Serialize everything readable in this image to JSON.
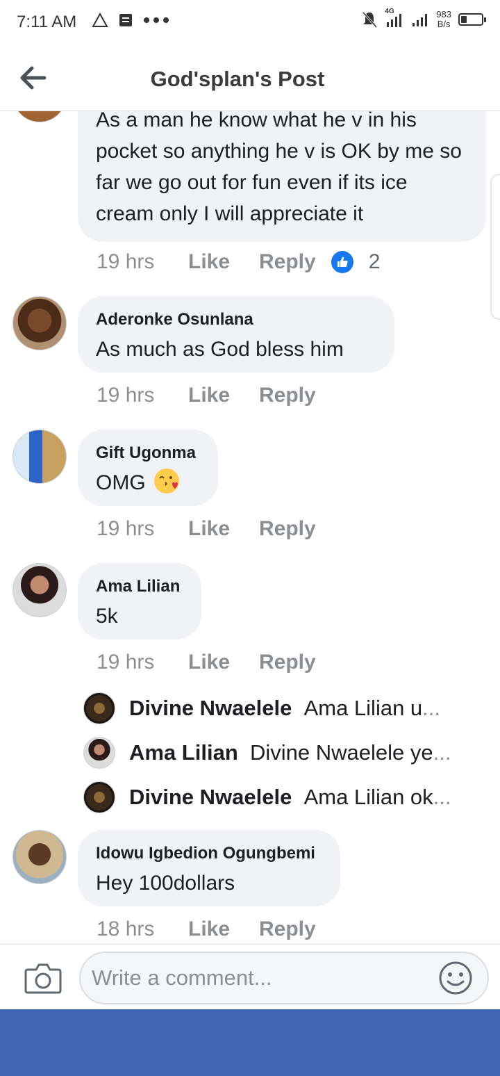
{
  "status_bar": {
    "time": "7:11 AM",
    "network_label": "4G",
    "speed_value": "983",
    "speed_unit": "B/s",
    "battery_level": 0.3
  },
  "header": {
    "title": "God'splan's Post"
  },
  "comments": [
    {
      "text": "As a man he know what he v in his pocket so anything he v is OK by me so far we go out for fun even if its ice cream only I will appreciate it",
      "time": "19 hrs",
      "like_label": "Like",
      "reply_label": "Reply",
      "reaction_count": "2"
    },
    {
      "name": "Aderonke Osunlana",
      "text": "As much as God bless him",
      "time": "19 hrs",
      "like_label": "Like",
      "reply_label": "Reply"
    },
    {
      "name": "Gift Ugonma",
      "text": "OMG",
      "emoji": "kissing-face-with-heart",
      "time": "19 hrs",
      "like_label": "Like",
      "reply_label": "Reply"
    },
    {
      "name": "Ama Lilian",
      "text": "5k",
      "time": "19 hrs",
      "like_label": "Like",
      "reply_label": "Reply",
      "replies": [
        {
          "name": "Divine Nwaelele",
          "text": "Ama Lilian u",
          "ellipsis": "..."
        },
        {
          "name": "Ama Lilian",
          "text": "Divine Nwaelele ye",
          "ellipsis": "..."
        },
        {
          "name": "Divine Nwaelele",
          "text": "Ama Lilian ok",
          "ellipsis": "..."
        }
      ]
    },
    {
      "name": "Idowu Igbedion Ogungbemi",
      "text": "Hey 100dollars",
      "time": "18 hrs",
      "like_label": "Like",
      "reply_label": "Reply"
    }
  ],
  "composer": {
    "placeholder": "Write a comment..."
  },
  "colors": {
    "brand_blue": "#4267b2",
    "like_blue": "#1877f2",
    "bubble_bg": "#f0f2f5",
    "meta_gray": "#8a8d91"
  }
}
